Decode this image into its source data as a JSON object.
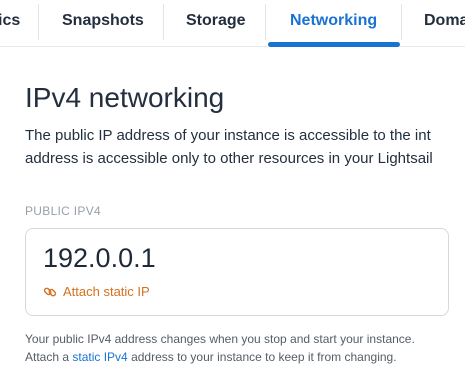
{
  "tabs": [
    {
      "label": "ics"
    },
    {
      "label": "Snapshots"
    },
    {
      "label": "Storage"
    },
    {
      "label": "Networking",
      "active": true
    },
    {
      "label": "Doma"
    }
  ],
  "section": {
    "title": "IPv4 networking",
    "description_line1": "The public IP address of your instance is accessible to the int",
    "description_line2": "address is accessible only to other resources in your Lightsail"
  },
  "public_ip": {
    "label": "PUBLIC IPV4",
    "value": "192.0.0.1",
    "attach_label": "Attach static IP",
    "attach_icon": "link-icon"
  },
  "help": {
    "line1": "Your public IPv4 address changes when you stop and start your instance.",
    "line2_prefix": "Attach a ",
    "line2_link": "static IPv4",
    "line2_suffix": " address to your instance to keep it from changing."
  },
  "colors": {
    "accent": "#1a73d1",
    "link_orange": "#d4701f",
    "text": "#232f3e",
    "muted": "#98a0aa"
  }
}
